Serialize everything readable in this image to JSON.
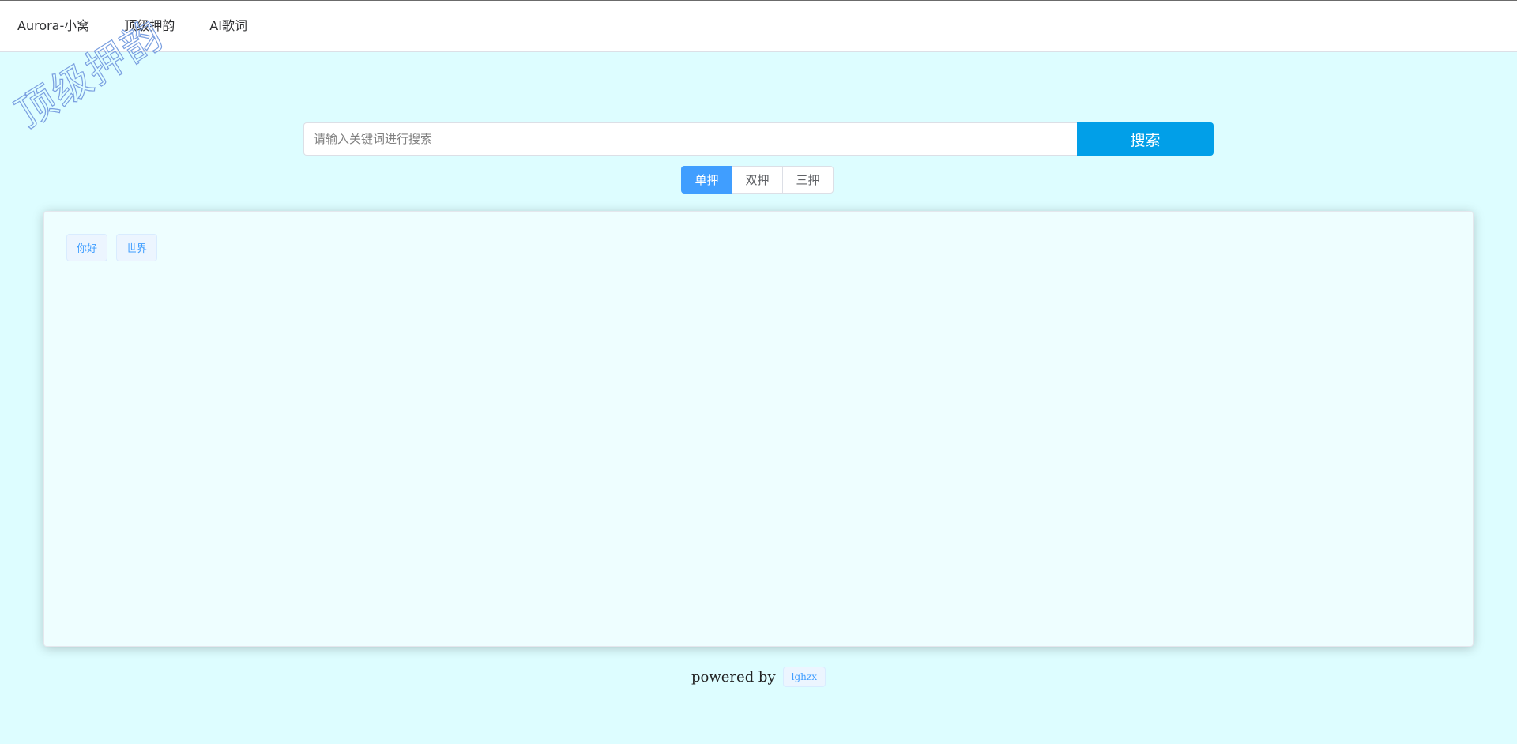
{
  "nav": {
    "items": [
      {
        "label": "Aurora-小窝"
      },
      {
        "label": "顶级押韵"
      },
      {
        "label": "AI歌词"
      }
    ]
  },
  "watermark": {
    "text": "顶级押韵"
  },
  "search": {
    "value": "",
    "placeholder": "请输入关键词进行搜索",
    "button_label": "搜索"
  },
  "rhyme_tabs": {
    "selected": "单押",
    "items": [
      {
        "label": "单押"
      },
      {
        "label": "双押"
      },
      {
        "label": "三押"
      }
    ]
  },
  "results": {
    "tags": [
      {
        "label": "你好"
      },
      {
        "label": "世界"
      }
    ]
  },
  "footer": {
    "powered_by": "powered by",
    "author": "lghzx"
  },
  "colors": {
    "page_background": "#ddfdff",
    "primary": "#409eff",
    "search_button": "#019fe8"
  }
}
